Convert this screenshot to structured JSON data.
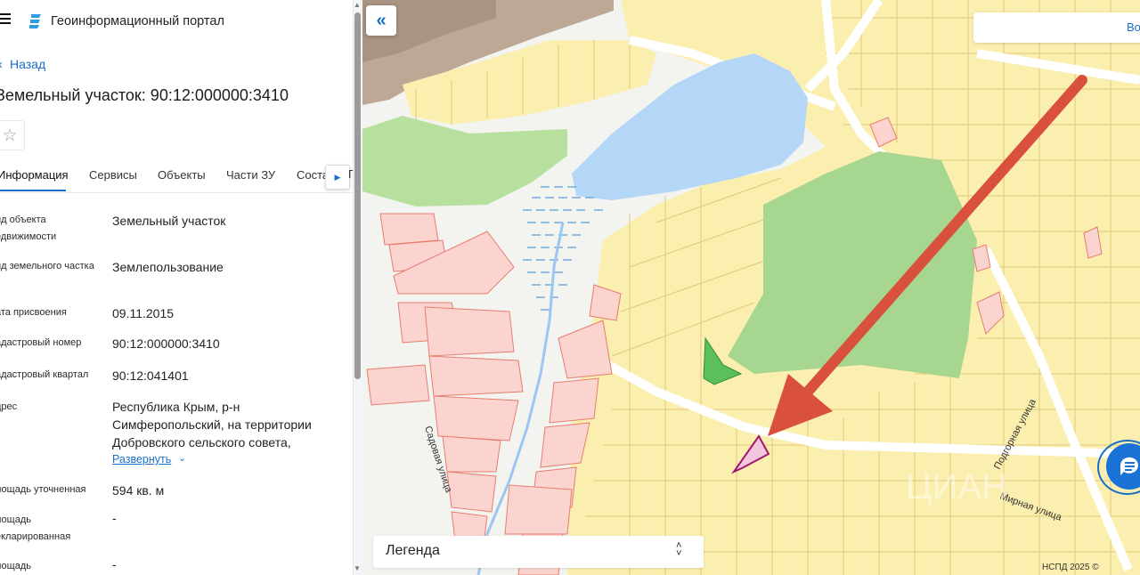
{
  "header": {
    "portal_title": "Геоинформационный портал"
  },
  "nav": {
    "back_label": "Назад"
  },
  "parcel": {
    "title": "Земельный участок: 90:12:000000:3410"
  },
  "tabs": [
    {
      "label": "Информация",
      "active": true
    },
    {
      "label": "Сервисы"
    },
    {
      "label": "Объекты"
    },
    {
      "label": "Части ЗУ"
    },
    {
      "label": "Соста"
    }
  ],
  "tab_overflow": "Г",
  "info": {
    "rows": [
      {
        "label": "ид объекта едвижимости",
        "value": "Земельный участок"
      },
      {
        "label": "ид земельного частка",
        "value": "Землепользование"
      },
      {
        "label": "ата присвоения",
        "value": "09.11.2015"
      },
      {
        "label": "адастровый номер",
        "value": "90:12:000000:3410"
      },
      {
        "label": "адастровый квартал",
        "value": "90:12:041401"
      },
      {
        "label": "дрес",
        "value": "Республика Крым, р-н Симферопольский, на территории Добровского сельского совета,"
      },
      {
        "label": "лощадь уточненная",
        "value": "594 кв. м"
      },
      {
        "label": "лощадь екларированная",
        "value": "-"
      },
      {
        "label": "лощадь",
        "value": "-"
      }
    ],
    "expand_label": "Развернуть"
  },
  "map": {
    "search_partial": "Во",
    "legend_label": "Легенда",
    "copyright": "НСПД 2025 ©",
    "streets": [
      "Садовая улица",
      "Подгорная улица",
      "Мирная улица"
    ],
    "watermark": "ЦИАН"
  },
  "colors": {
    "accent": "#1a6dc9",
    "parcel_fill": "#fbefb0",
    "parcel_border": "#e0c878",
    "water": "#b4d6f7",
    "park": "#a6d68f",
    "arrow": "#d9503c",
    "highlight": "#a0186e"
  },
  "icons": [
    "menu-icon",
    "logo-icon",
    "star-icon",
    "chevron-left-icon",
    "chevron-right-icon",
    "chevron-down-icon",
    "double-chevron-left-icon",
    "sort-icon",
    "chat-icon"
  ]
}
